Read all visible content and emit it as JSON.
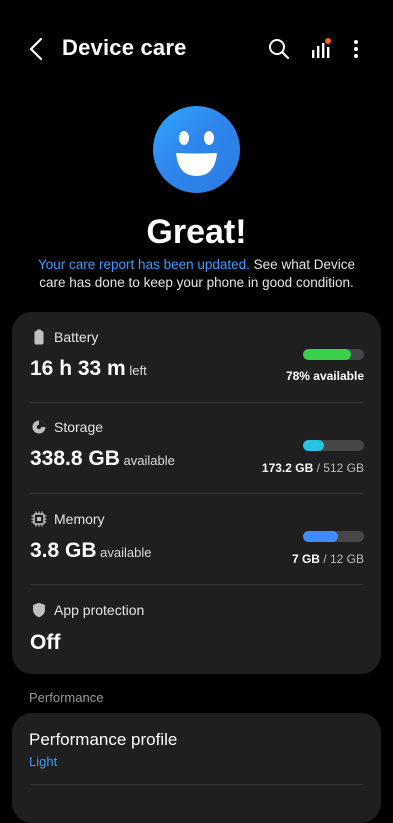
{
  "header": {
    "title": "Device care"
  },
  "status": {
    "headline": "Great!",
    "report_link": "Your care report has been updated.",
    "report_text": " See what Device care has done to keep your phone in good condition."
  },
  "battery": {
    "label": "Battery",
    "value": "16 h 33 m",
    "unit": " left",
    "available": "78% available",
    "fill_fraction": 0.78,
    "color": "#3ad14a"
  },
  "storage": {
    "label": "Storage",
    "value": "338.8 GB",
    "unit": " available",
    "used": "173.2 GB",
    "total": " / 512 GB",
    "fill_fraction": 0.34,
    "color": "#27c3e0"
  },
  "memory": {
    "label": "Memory",
    "value": "3.8 GB",
    "unit": " available",
    "used": "7 GB",
    "total": " / 12 GB",
    "fill_fraction": 0.58,
    "color": "#3f8cff"
  },
  "protection": {
    "label": "App protection",
    "value": "Off"
  },
  "performance": {
    "section": "Performance",
    "profile_title": "Performance profile",
    "profile_value": "Light"
  },
  "icons": [
    "back-icon",
    "search-icon",
    "stats-icon",
    "more-icon",
    "smiley-face-icon",
    "battery-icon",
    "storage-icon",
    "memory-icon",
    "shield-icon"
  ]
}
